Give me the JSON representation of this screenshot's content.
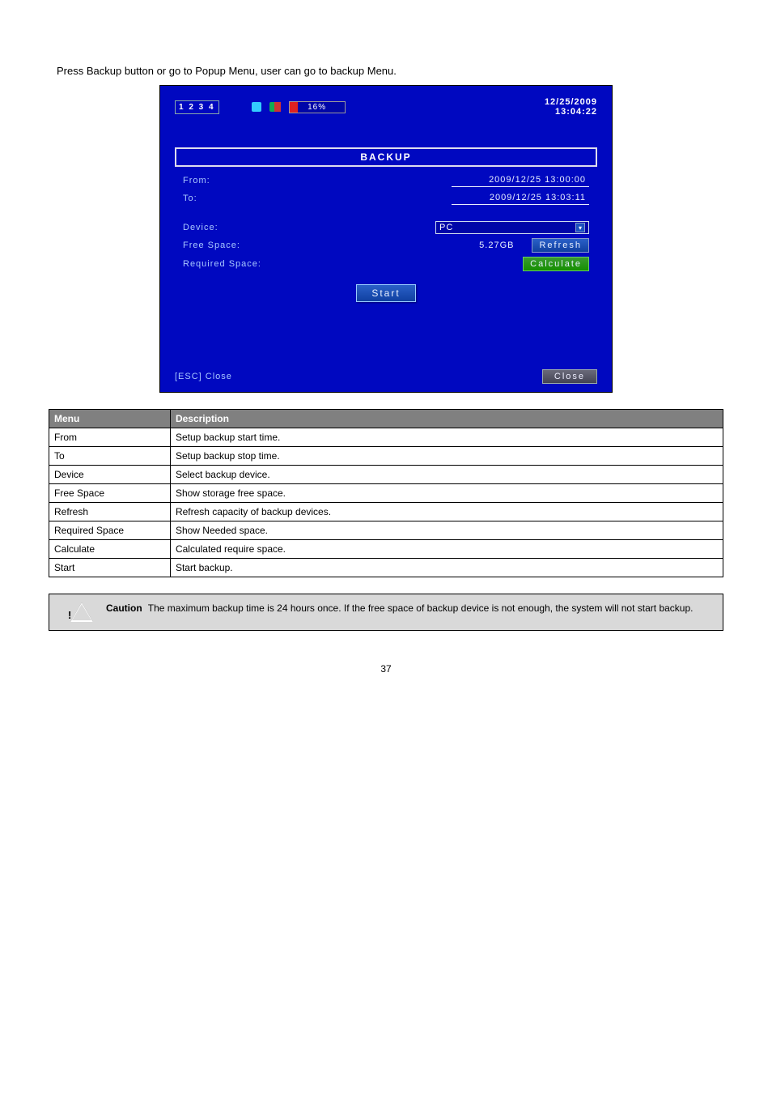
{
  "intro": "Press Backup button or go to Popup Menu, user can go to backup Menu.",
  "dvr": {
    "channels": "1 2 3 4",
    "usage_percent": "16%",
    "date": "12/25/2009",
    "time": "13:04:22",
    "panel_title": "BACKUP",
    "from_label": "From:",
    "from_value": "2009/12/25 13:00:00",
    "to_label": "To:",
    "to_value": "2009/12/25 13:03:11",
    "device_label": "Device:",
    "device_value": "PC",
    "free_label": "Free Space:",
    "free_value": "5.27GB",
    "required_label": "Required Space:",
    "refresh_btn": "Refresh",
    "calculate_btn": "Calculate",
    "start_btn": "Start",
    "esc_hint": "[ESC] Close",
    "close_btn": "Close"
  },
  "table": {
    "head_menu": "Menu",
    "head_desc": "Description",
    "rows": [
      {
        "menu": "From",
        "desc": "Setup backup start time."
      },
      {
        "menu": "To",
        "desc": "Setup backup stop time."
      },
      {
        "menu": "Device",
        "desc": "Select backup device."
      },
      {
        "menu": "Free Space",
        "desc": "Show storage free space."
      },
      {
        "menu": "Refresh",
        "desc": "Refresh capacity of backup devices."
      },
      {
        "menu": "Required Space",
        "desc": "Show Needed space."
      },
      {
        "menu": "Calculate",
        "desc": "Calculated require space."
      },
      {
        "menu": "Start",
        "desc": "Start backup."
      }
    ]
  },
  "caution": {
    "label": "Caution",
    "text": "The maximum backup time is 24 hours once. If the free space of backup device is not enough, the system will not start backup."
  },
  "page_num": "37"
}
